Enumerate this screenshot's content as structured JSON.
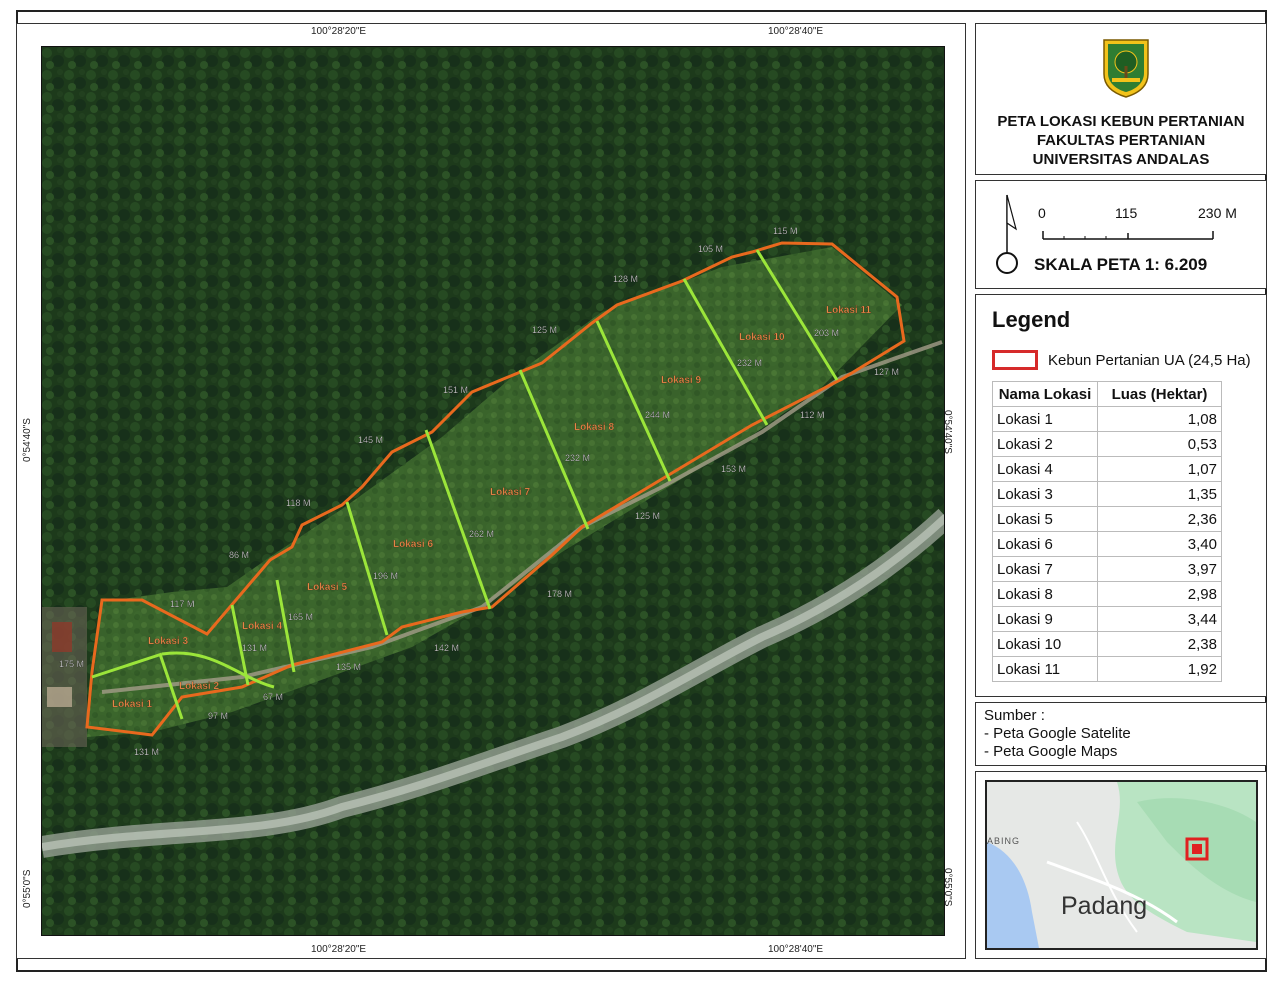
{
  "map": {
    "coords": {
      "top_left": "100°28'20\"E",
      "top_right": "100°28'40\"E",
      "bottom_left": "100°28'20\"E",
      "bottom_right": "100°28'40\"E",
      "left_upper": "0°54'40\"S",
      "left_lower": "0°55'0\"S",
      "right_upper": "0°54'40\"S",
      "right_lower": "0°55'0\"S"
    },
    "boundary_color": "#e8691e",
    "divider_color": "#9be53a",
    "lot_labels": [
      "Lokasi 1",
      "Lokasi 2",
      "Lokasi 3",
      "Lokasi 4",
      "Lokasi 5",
      "Lokasi 6",
      "Lokasi 7",
      "Lokasi 8",
      "Lokasi 9",
      "Lokasi 10",
      "Lokasi 11"
    ],
    "measurements": [
      "175 M",
      "117 M",
      "86 M",
      "118 M",
      "145 M",
      "151 M",
      "125 M",
      "128 M",
      "105 M",
      "115 M",
      "131 M",
      "165 M",
      "196 M",
      "262 M",
      "232 M",
      "244 M",
      "232 M",
      "203 M",
      "127 M",
      "112 M",
      "153 M",
      "125 M",
      "178 M",
      "142 M",
      "135 M",
      "67 M",
      "97 M",
      "131 M"
    ]
  },
  "title": {
    "logo": "universitas-andalas-emblem",
    "line1": "PETA LOKASI KEBUN PERTANIAN",
    "line2": "FAKULTAS PERTANIAN",
    "line3": "UNIVERSITAS ANDALAS"
  },
  "scale": {
    "tick0": "0",
    "tick1": "115",
    "tick2": "230  M",
    "text": "SKALA PETA 1: 6.209"
  },
  "legend": {
    "title": "Legend",
    "item_label": "Kebun Pertanian UA (24,5 Ha)",
    "item_color": "#d62a2a",
    "table": {
      "headers": [
        "Nama Lokasi",
        "Luas (Hektar)"
      ],
      "rows": [
        [
          "Lokasi 1",
          "1,08"
        ],
        [
          "Lokasi 2",
          "0,53"
        ],
        [
          "Lokasi 4",
          "1,07"
        ],
        [
          "Lokasi 3",
          "1,35"
        ],
        [
          "Lokasi 5",
          "2,36"
        ],
        [
          "Lokasi 6",
          "3,40"
        ],
        [
          "Lokasi 7",
          "3,97"
        ],
        [
          "Lokasi 8",
          "2,98"
        ],
        [
          "Lokasi 9",
          "3,44"
        ],
        [
          "Lokasi 10",
          "2,38"
        ],
        [
          "Lokasi 11",
          "1,92"
        ]
      ]
    }
  },
  "sources": {
    "heading": "Sumber :",
    "items": [
      "- Peta Google Satelite",
      "- Peta Google Maps"
    ]
  },
  "inset": {
    "city": "Padang",
    "edge_label": "ABING",
    "marker_color": "#e02020"
  }
}
